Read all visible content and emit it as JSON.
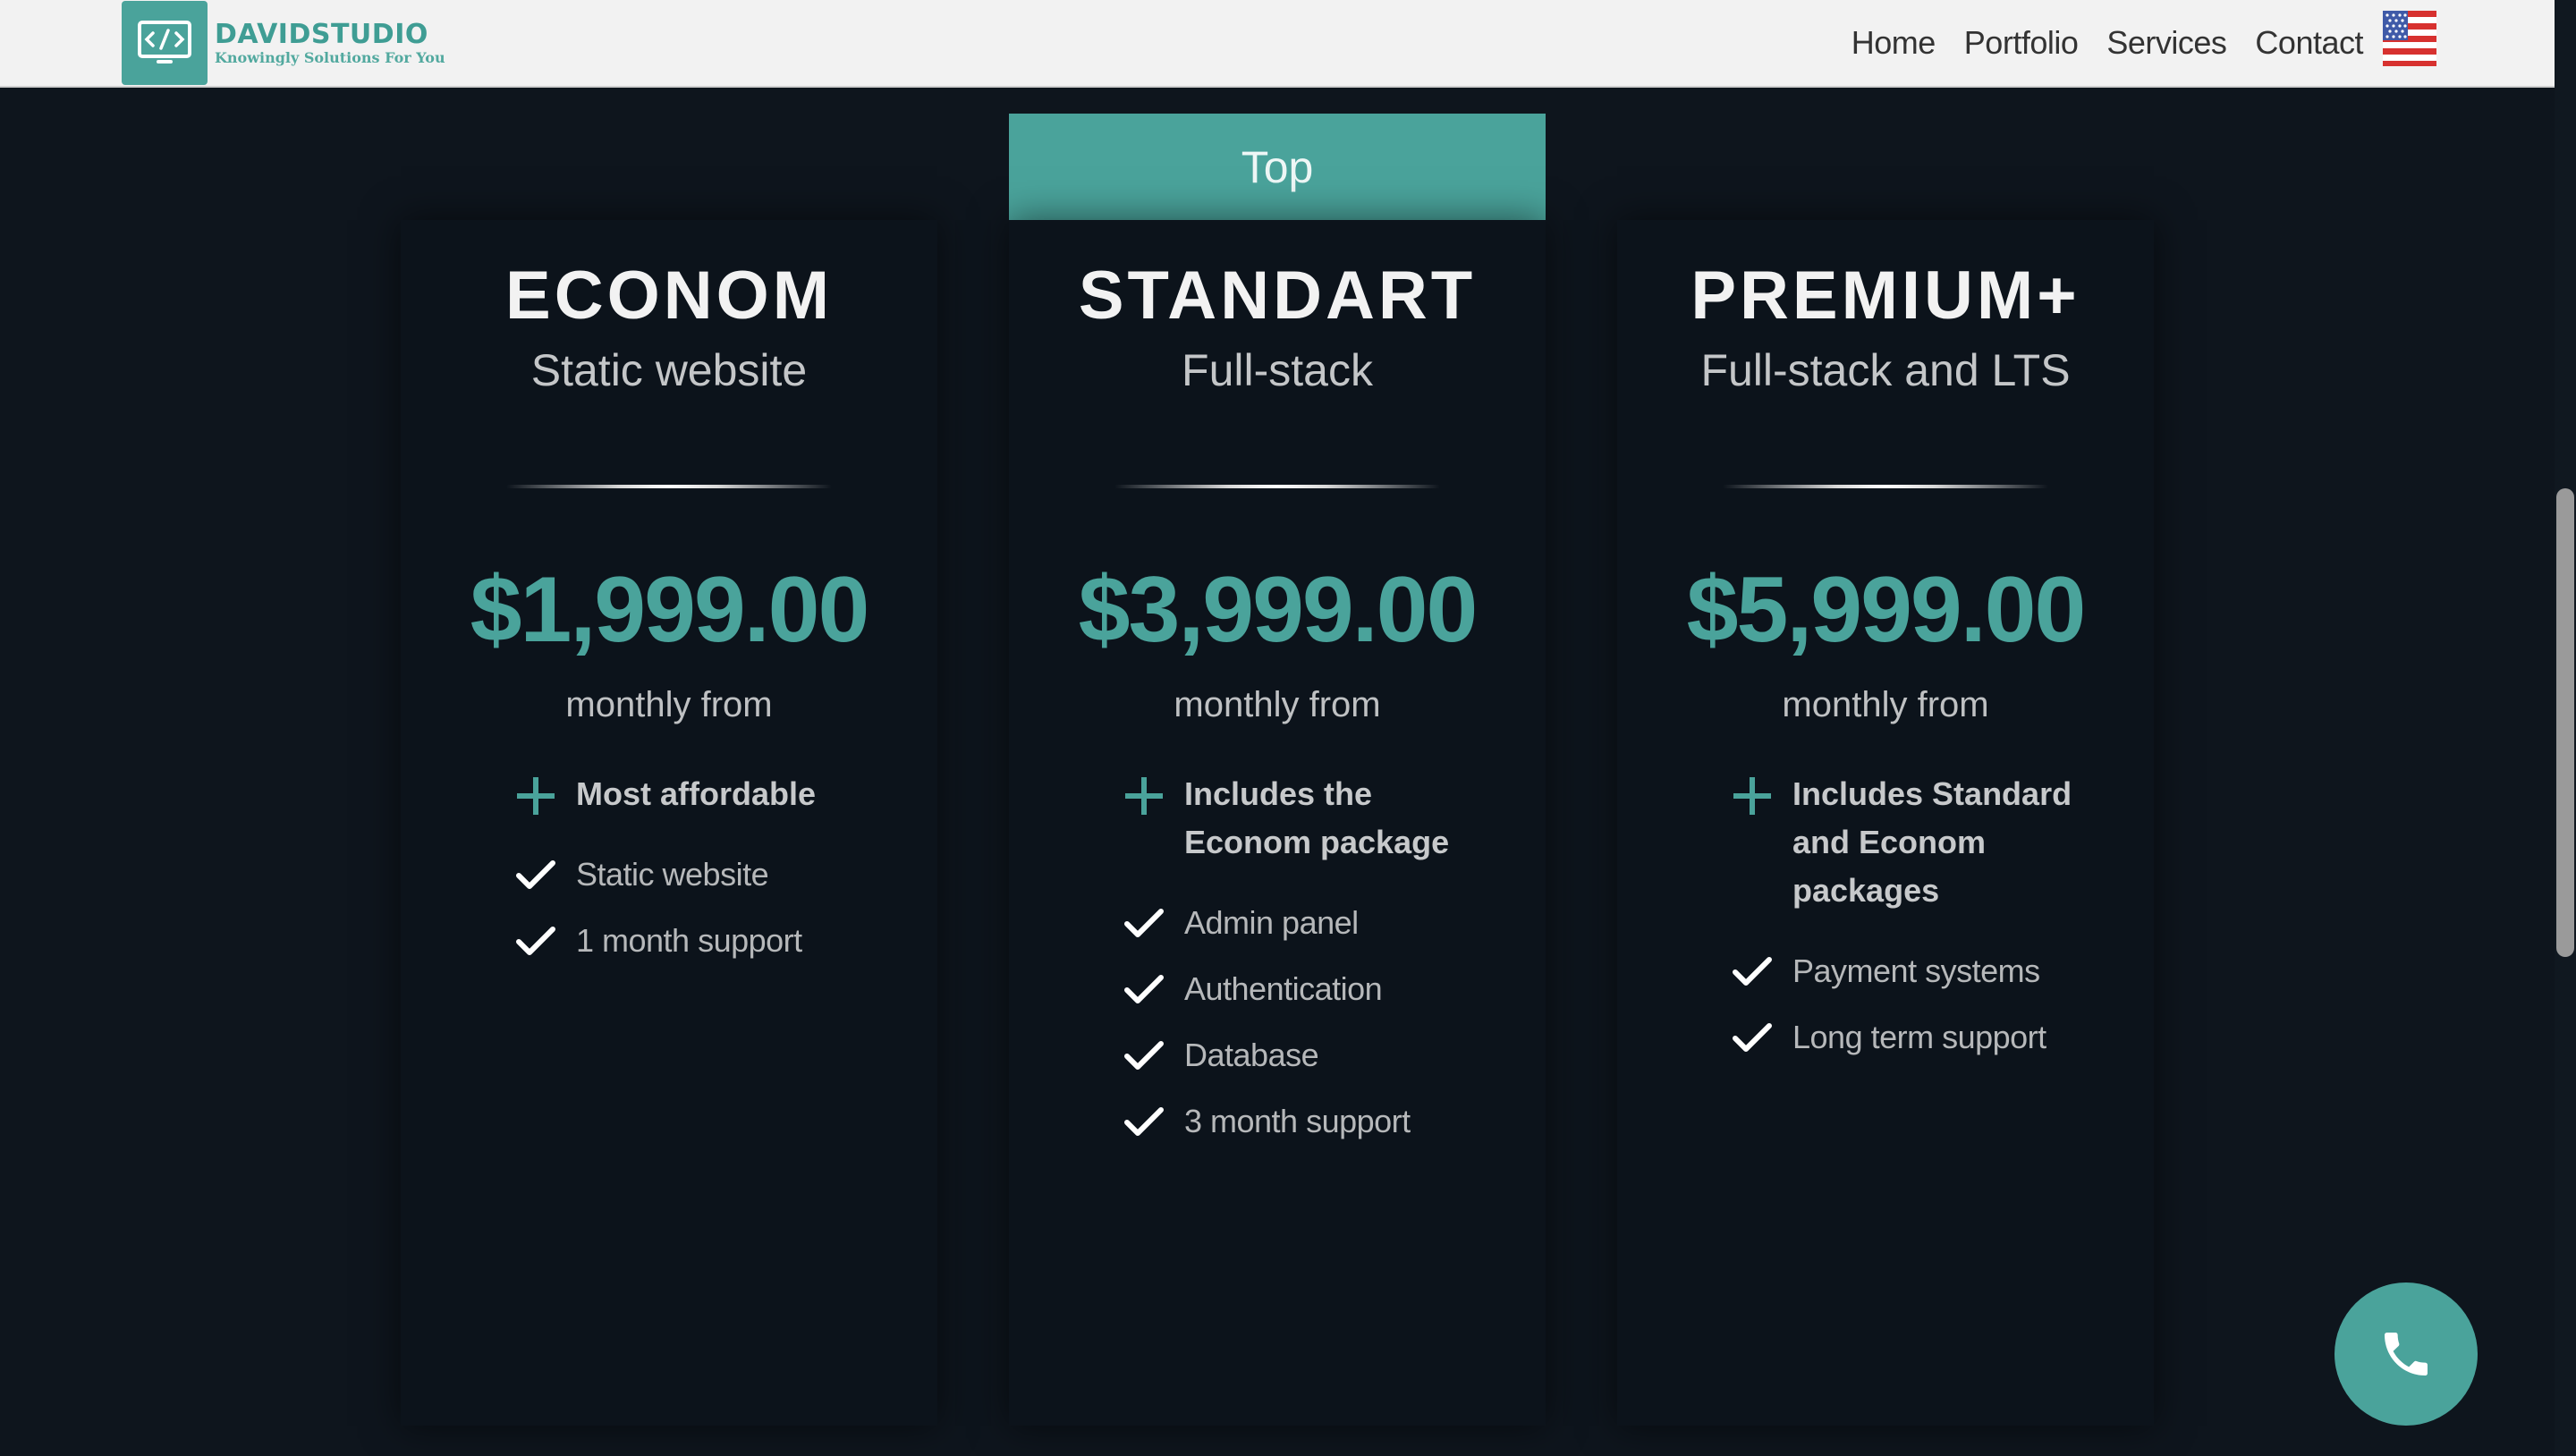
{
  "header": {
    "brand_title": "DAVIDSTUDIO",
    "brand_tagline": "Knowingly Solutions For You",
    "nav": [
      "Home",
      "Portfolio",
      "Services",
      "Contact"
    ],
    "language_icon": "us-flag-icon"
  },
  "pricing": {
    "badge": "Top",
    "price_note": "monthly from",
    "plans": [
      {
        "title": "ECONOM",
        "subtitle": "Static website",
        "price": "$1,999.00",
        "note": "monthly from",
        "highlight": "Most affordable",
        "features": [
          "Static website",
          "1 month support"
        ]
      },
      {
        "title": "STANDART",
        "subtitle": "Full-stack",
        "price": "$3,999.00",
        "note": "monthly from",
        "highlight": "Includes the Econom package",
        "features": [
          "Admin panel",
          "Authentication",
          "Database",
          "3 month support"
        ]
      },
      {
        "title": "PREMIUM+",
        "subtitle": "Full-stack and LTS",
        "price": "$5,999.00",
        "note": "monthly from",
        "highlight": "Includes Standard and Econom packages",
        "features": [
          "Payment systems",
          "Long term support"
        ]
      }
    ]
  },
  "colors": {
    "accent": "#4aa39b",
    "background": "#0e151d",
    "card": "#0c131b",
    "header": "#f2f2f2"
  },
  "icons": {
    "plus": "plus-icon",
    "check": "check-icon",
    "phone": "phone-icon",
    "logo": "code-laptop-icon"
  }
}
